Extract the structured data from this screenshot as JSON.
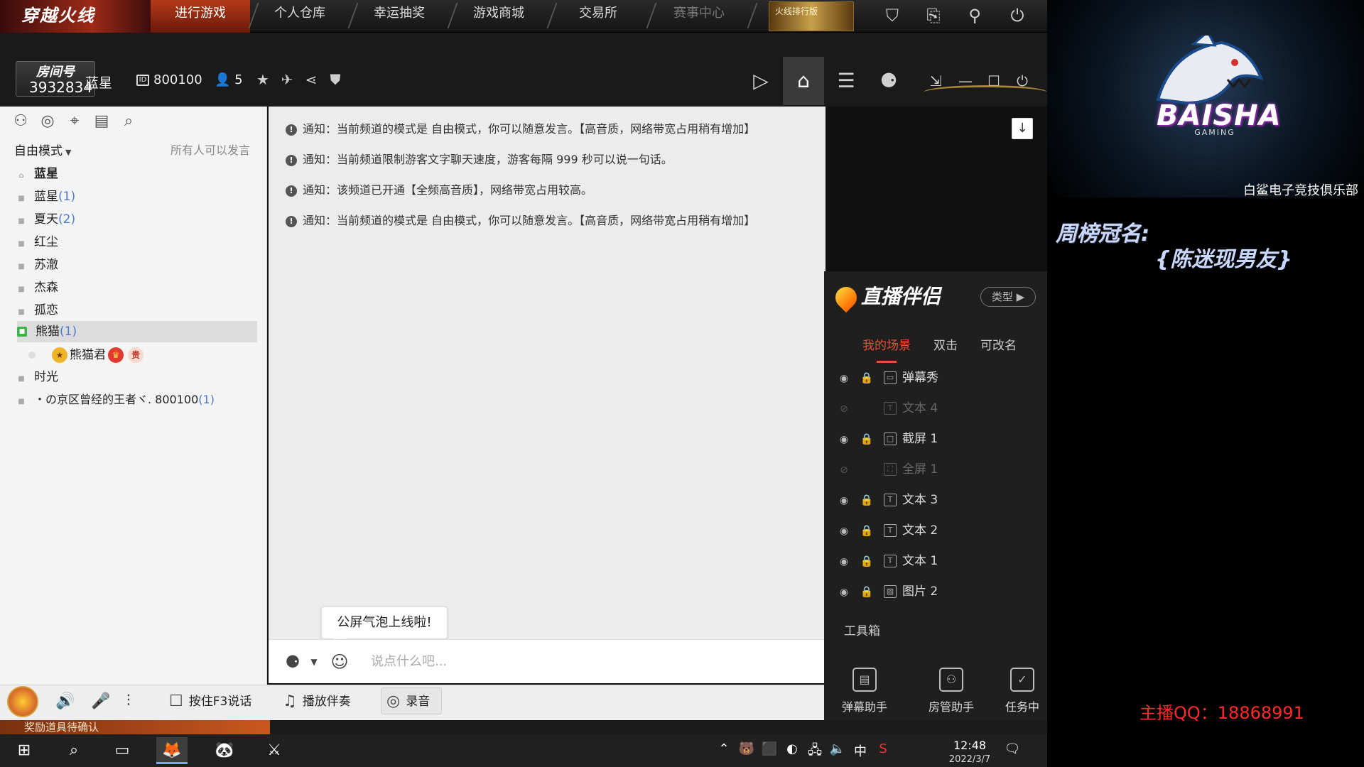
{
  "topnav": {
    "logo": "穿越火线",
    "tabs": [
      "进行游戏",
      "个人仓库",
      "幸运抽奖",
      "游戏商城",
      "交易所",
      "赛事中心"
    ],
    "active_tab": 0,
    "promo": "火线排行版"
  },
  "room": {
    "badge_label": "房间号",
    "room_number": "3932834",
    "name": "蓝星",
    "id": "800100",
    "user_count": "5"
  },
  "left": {
    "mode": "自由模式",
    "mode_desc": "所有人可以发言",
    "channels": [
      {
        "name": "蓝星",
        "count": ""
      },
      {
        "name": "蓝星",
        "count": "(1)"
      },
      {
        "name": "夏天",
        "count": "(2)"
      },
      {
        "name": "红尘",
        "count": ""
      },
      {
        "name": "苏澈",
        "count": ""
      },
      {
        "name": "杰森",
        "count": ""
      },
      {
        "name": "孤恋",
        "count": ""
      },
      {
        "name": "熊猫",
        "count": "(1)"
      },
      {
        "name": "时光",
        "count": ""
      },
      {
        "name": "・の京区曾经的王者ヾ. 800100",
        "count": "(1)"
      }
    ],
    "member": {
      "name": "熊猫君",
      "medal_text": "贵"
    }
  },
  "chat": {
    "notices": [
      "通知：当前频道的模式是 自由模式，你可以随意发言。【高音质，网络带宽占用稍有增加】",
      "通知：当前频道限制游客文字聊天速度，游客每隔 999 秒可以说一句话。",
      "通知：该频道已开通【全频高音质】，网络带宽占用较高。",
      "通知：当前频道的模式是 自由模式，你可以随意发言。【高音质，网络带宽占用稍有增加】"
    ],
    "bubble": "公屏气泡上线啦!",
    "input_placeholder": "说点什么吧..."
  },
  "bottombar": {
    "ptt": "按住F3说话",
    "music": "播放伴奏",
    "record": "录音"
  },
  "reward_strip": "奖励道具待确认",
  "companion": {
    "title": "直播伴侣",
    "type_btn": "类型",
    "tabs": [
      "我的场景",
      "双击",
      "可改名"
    ],
    "scenes": [
      {
        "name": "弹幕秀",
        "visible": true,
        "locked": true
      },
      {
        "name": "文本 4",
        "visible": false,
        "locked": false
      },
      {
        "name": "截屏 1",
        "visible": true,
        "locked": true
      },
      {
        "name": "全屏 1",
        "visible": false,
        "locked": false
      },
      {
        "name": "文本 3",
        "visible": true,
        "locked": true
      },
      {
        "name": "文本 2",
        "visible": true,
        "locked": true
      },
      {
        "name": "文本 1",
        "visible": true,
        "locked": true
      },
      {
        "name": "图片 2",
        "visible": true,
        "locked": true
      }
    ],
    "toolbox": "工具箱",
    "tools": [
      "弹幕助手",
      "房管助手",
      "任务中"
    ]
  },
  "taskbar": {
    "tray_lang": "中",
    "time": "12:48",
    "date": "2022/3/7"
  },
  "overlay": {
    "brand": "BAISHA",
    "brand_sub": "GAMING",
    "club": "白鲨电子竞技俱乐部",
    "week_title": "周榜冠名:",
    "week_name": "{陈迷现男友}",
    "qq": "主播QQ：18868991"
  },
  "colors": {
    "accent_red": "#e8503a",
    "qq_red": "#ff2a2a",
    "channel_count": "#4a7bd1",
    "selected_channel_icon": "#39b54a"
  }
}
